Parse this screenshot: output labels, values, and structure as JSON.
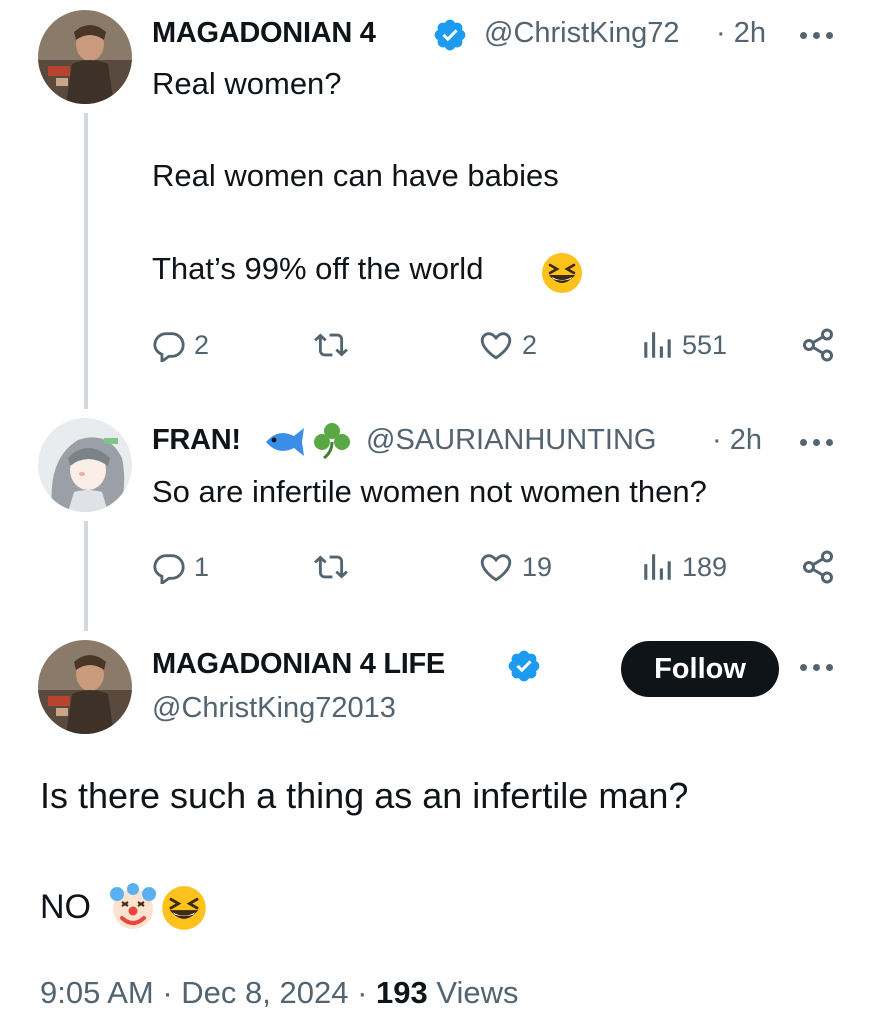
{
  "tweet1": {
    "name": "MAGADONIAN 4",
    "handle": "@ChristKing72",
    "time": "· 2h",
    "lines": [
      "Real women?",
      "Real women can have babies",
      "That’s 99% off the world"
    ],
    "reply_count": "2",
    "like_count": "2",
    "view_count": "551"
  },
  "tweet2": {
    "name": "FRAN!",
    "handle": "@SAURIANHUNTING",
    "time": "· 2h",
    "text": "So are infertile women not women then?",
    "reply_count": "1",
    "like_count": "19",
    "view_count": "189"
  },
  "main_tweet": {
    "name": "MAGADONIAN 4 LIFE",
    "handle": "@ChristKing72013",
    "follow_label": "Follow",
    "text_line1": "Is there such a thing as an infertile man?",
    "text_line2": "NO",
    "timestamp": "9:05 AM · Dec 8, 2024 ·",
    "views_count": "193",
    "views_label": "Views"
  },
  "icons": {
    "verified": "verified-badge-icon",
    "reply": "reply-icon",
    "retweet": "retweet-icon",
    "like": "heart-icon",
    "views": "views-bar-icon",
    "share": "share-icon",
    "more": "more-dots-icon"
  },
  "colors": {
    "text": "#0f1419",
    "secondary": "#536471",
    "verified": "#1d9bf0",
    "thread_line": "#cfd9de",
    "follow_bg": "#0f1419"
  }
}
